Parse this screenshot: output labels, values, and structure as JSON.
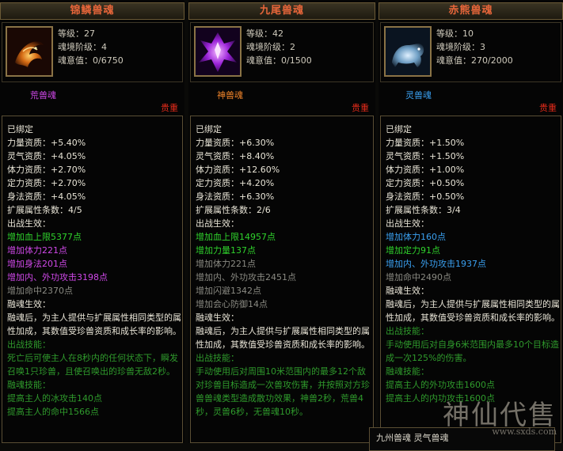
{
  "panels": [
    {
      "title": "锦鳞兽魂",
      "level": "等级：27",
      "realm": "魂境阶级：4",
      "intent": "魂意值：0/6750",
      "tier": "荒兽魂",
      "tier_color": "#cf48e8",
      "rare": "贵重",
      "icon": "fire-fish-icon",
      "lines": [
        {
          "t": "已绑定",
          "c": "w"
        },
        {
          "t": "力量资质：+5.40%",
          "c": "w"
        },
        {
          "t": "灵气资质：+4.05%",
          "c": "w"
        },
        {
          "t": "体力资质：+2.70%",
          "c": "w"
        },
        {
          "t": "定力资质：+2.70%",
          "c": "w"
        },
        {
          "t": "身法资质：+4.05%",
          "c": "w"
        },
        {
          "t": "扩展属性条数：4/5",
          "c": "w"
        },
        {
          "t": "出战生效：",
          "c": "w"
        },
        {
          "t": "增加血上限5377点",
          "c": "g"
        },
        {
          "t": "增加体力221点",
          "c": "p"
        },
        {
          "t": "增加身法201点",
          "c": "p"
        },
        {
          "t": "增加内、外功攻击3198点",
          "c": "p"
        },
        {
          "t": "增加命中2370点",
          "c": "gr"
        },
        {
          "t": "融魂生效：",
          "c": "w"
        },
        {
          "t": "融魂后，为主人提供与扩展属性相同类型的属性加成，其数值受珍兽资质和成长率的影响。",
          "c": "w",
          "wrap": true
        },
        {
          "t": "出战技能：",
          "c": "dg"
        },
        {
          "t": "死亡后可使主人在8秒内的任何状态下，瞬发召唤1只珍兽，且使召唤出的珍兽无敌2秒。",
          "c": "dg",
          "wrap": true
        },
        {
          "t": "融魂技能：",
          "c": "dg"
        },
        {
          "t": "提高主人的冰攻击140点",
          "c": "dg"
        },
        {
          "t": "提高主人的命中1566点",
          "c": "dg"
        }
      ]
    },
    {
      "title": "九尾兽魂",
      "level": "等级：42",
      "realm": "魂境阶级：2",
      "intent": "魂意值：0/1500",
      "tier": "神兽魂",
      "tier_color": "#f0842a",
      "rare": "贵重",
      "icon": "nine-tail-crystal-icon",
      "lines": [
        {
          "t": "已绑定",
          "c": "w"
        },
        {
          "t": "力量资质：+6.30%",
          "c": "w"
        },
        {
          "t": "灵气资质：+8.40%",
          "c": "w"
        },
        {
          "t": "体力资质：+12.60%",
          "c": "w"
        },
        {
          "t": "定力资质：+4.20%",
          "c": "w"
        },
        {
          "t": "身法资质：+6.30%",
          "c": "w"
        },
        {
          "t": "扩展属性条数：2/6",
          "c": "w"
        },
        {
          "t": "出战生效：",
          "c": "w"
        },
        {
          "t": "增加血上限14957点",
          "c": "g"
        },
        {
          "t": "增加力量137点",
          "c": "g"
        },
        {
          "t": "增加体力221点",
          "c": "gr"
        },
        {
          "t": "增加内、外功攻击2451点",
          "c": "gr"
        },
        {
          "t": "增加闪避1342点",
          "c": "gr"
        },
        {
          "t": "增加会心防御14点",
          "c": "gr"
        },
        {
          "t": "融魂生效：",
          "c": "w"
        },
        {
          "t": "融魂后，为主人提供与扩展属性相同类型的属性加成，其数值受珍兽资质和成长率的影响。",
          "c": "w",
          "wrap": true
        },
        {
          "t": "出战技能：",
          "c": "dg"
        },
        {
          "t": "手动使用后对周围10米范围内的最多12个敌对珍兽目标造成一次兽攻伤害，并按照对方珍兽兽魂类型造成散功效果，神兽2秒，荒兽4秒，灵兽6秒，无兽魂10秒。",
          "c": "dg",
          "wrap": true
        }
      ]
    },
    {
      "title": "赤熊兽魂",
      "level": "等级：10",
      "realm": "魂境阶级：3",
      "intent": "魂意值：270/2000",
      "tier": "灵兽魂",
      "tier_color": "#3aa0f0",
      "rare": "贵重",
      "icon": "ice-bear-icon",
      "lines": [
        {
          "t": "已绑定",
          "c": "w"
        },
        {
          "t": "力量资质：+1.50%",
          "c": "w"
        },
        {
          "t": "灵气资质：+1.50%",
          "c": "w"
        },
        {
          "t": "体力资质：+1.00%",
          "c": "w"
        },
        {
          "t": "定力资质：+0.50%",
          "c": "w"
        },
        {
          "t": "身法资质：+0.50%",
          "c": "w"
        },
        {
          "t": "扩展属性条数：3/4",
          "c": "w"
        },
        {
          "t": "出战生效：",
          "c": "w"
        },
        {
          "t": "增加体力160点",
          "c": "b"
        },
        {
          "t": "增加定力91点",
          "c": "g"
        },
        {
          "t": "增加内、外功攻击1937点",
          "c": "b"
        },
        {
          "t": "增加命中2490点",
          "c": "gr"
        },
        {
          "t": "融魂生效：",
          "c": "w"
        },
        {
          "t": "融魂后，为主人提供与扩展属性相同类型的属性加成，其数值受珍兽资质和成长率的影响。",
          "c": "w",
          "wrap": true
        },
        {
          "t": "出战技能：",
          "c": "dg"
        },
        {
          "t": "手动使用后对自身6米范围内最多10个目标造成一次125%的伤害。",
          "c": "dg",
          "wrap": true
        },
        {
          "t": "融魂技能：",
          "c": "dg"
        },
        {
          "t": "提高主人的外功攻击1600点",
          "c": "dg"
        },
        {
          "t": "提高主人的内功攻击1600点",
          "c": "dg"
        }
      ]
    }
  ],
  "subpanel_text": "九州兽魂  灵气兽魂",
  "watermark": {
    "mark": "神仙代售",
    "url": "www.sxds.com"
  }
}
